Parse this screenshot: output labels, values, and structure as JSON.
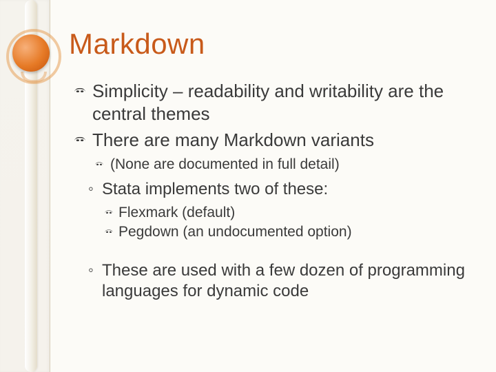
{
  "title": "Markdown",
  "bullets": {
    "b1": "Simplicity – readability and writability are the central themes",
    "b2": "There are many Markdown variants",
    "b2a": "(None are documented in full detail)",
    "b3": "Stata implements two of these:",
    "b3a": "Flexmark (default)",
    "b3b": "Pegdown (an undocumented option)",
    "b4": "These are used with a few dozen of programming languages for dynamic code"
  }
}
